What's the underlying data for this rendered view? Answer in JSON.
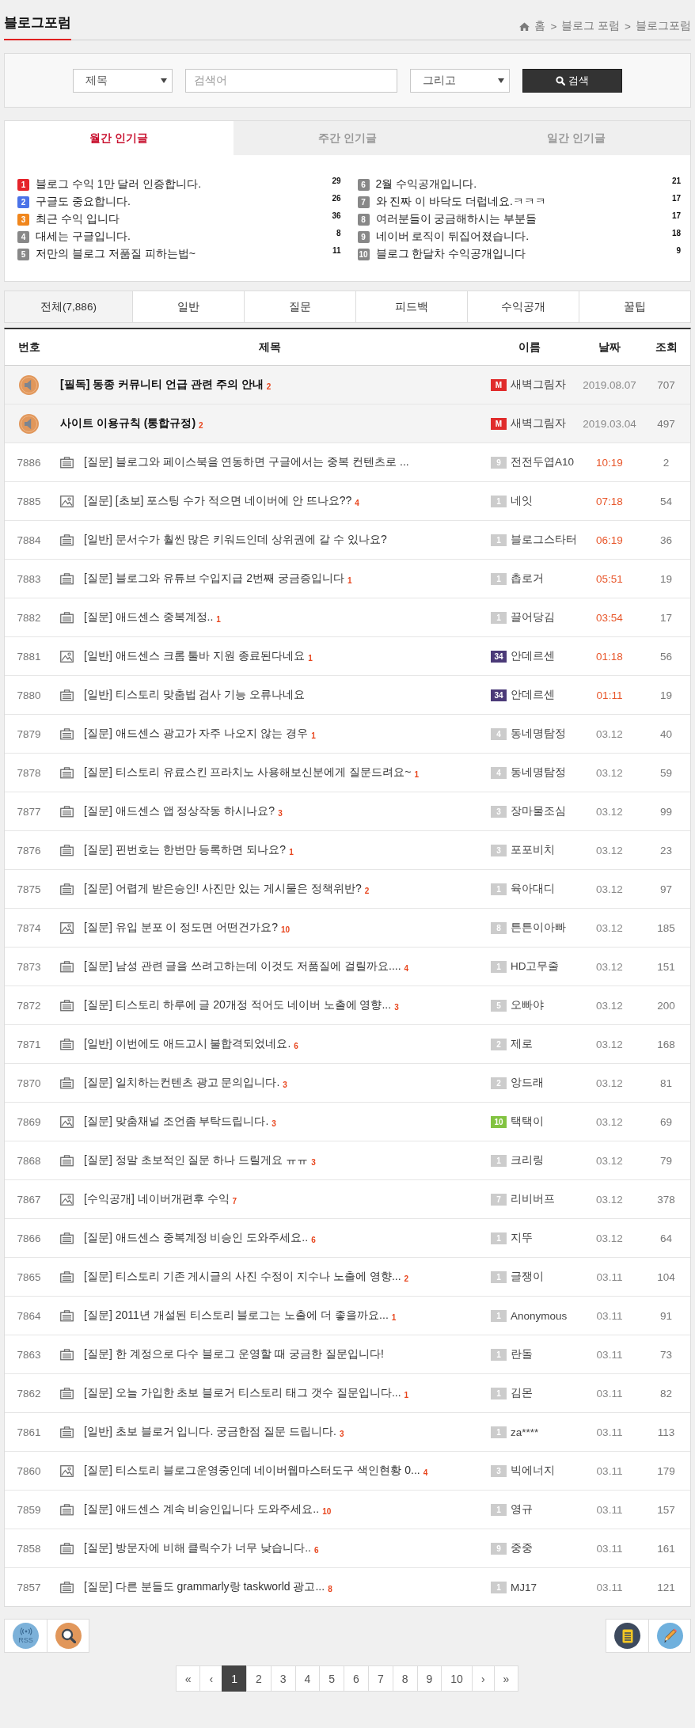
{
  "header": {
    "title": "블로그포럼",
    "breadcrumb": {
      "items": [
        "홈",
        "블로그 포럼",
        "블로그포럼"
      ],
      "separator": ">"
    }
  },
  "search": {
    "field": "제목",
    "placeholder": "검색어",
    "operator": "그리고",
    "button": "검색"
  },
  "popular": {
    "tabs": [
      {
        "label": "월간 인기글",
        "selected": true
      },
      {
        "label": "주간 인기글",
        "selected": false
      },
      {
        "label": "일간 인기글",
        "selected": false
      }
    ],
    "items": [
      {
        "rank": "1",
        "color": "#e5242b",
        "title": "블로그 수익 1만 달러 인증합니다.",
        "count": "29"
      },
      {
        "rank": "2",
        "color": "#4a72e8",
        "title": "구글도 중요합니다.",
        "count": "26"
      },
      {
        "rank": "3",
        "color": "#f0861c",
        "title": "최근 수익 입니다",
        "count": "36"
      },
      {
        "rank": "4",
        "color": "#888888",
        "title": "대세는 구글입니다.",
        "count": "8"
      },
      {
        "rank": "5",
        "color": "#888888",
        "title": "저만의 블로그 저품질 피하는법~",
        "count": "11"
      },
      {
        "rank": "6",
        "color": "#888888",
        "title": "2월 수익공개입니다.",
        "count": "21"
      },
      {
        "rank": "7",
        "color": "#888888",
        "title": "와 진짜 이 바닥도 더럽네요.ㅋㅋㅋ",
        "count": "17"
      },
      {
        "rank": "8",
        "color": "#888888",
        "title": "여러분들이 궁금해하시는 부분들",
        "count": "17"
      },
      {
        "rank": "9",
        "color": "#888888",
        "title": "네이버 로직이 뒤집어졌습니다.",
        "count": "18"
      },
      {
        "rank": "10",
        "color": "#888888",
        "title": "블로그 한달차 수익공개입니다",
        "count": "9"
      }
    ]
  },
  "categories": [
    {
      "label": "전체(7,886)",
      "selected": true
    },
    {
      "label": "일반",
      "selected": false
    },
    {
      "label": "질문",
      "selected": false
    },
    {
      "label": "피드백",
      "selected": false
    },
    {
      "label": "수익공개",
      "selected": false
    },
    {
      "label": "꿀팁",
      "selected": false
    }
  ],
  "table": {
    "columns": [
      "번호",
      "제목",
      "이름",
      "날짜",
      "조회"
    ],
    "notices": [
      {
        "title": "[필독] 동종 커뮤니티 언급 관련 주의 안내",
        "comments": "2",
        "author": {
          "badge": "M",
          "color": "#e02b2b",
          "name": "새벽그림자"
        },
        "date": "2019.08.07",
        "views": "707"
      },
      {
        "title": "사이트 이용규칙 (통합규정)",
        "comments": "2",
        "author": {
          "badge": "M",
          "color": "#e02b2b",
          "name": "새벽그림자"
        },
        "date": "2019.03.04",
        "views": "497"
      }
    ],
    "posts": [
      {
        "number": "7886",
        "has_image": false,
        "title": "[질문] 블로그와 페이스북을 연동하면 구글에서는 중복 컨텐츠로 ...",
        "author": {
          "badge": "9",
          "color": "#cccccc",
          "name": "전전두엽A10"
        },
        "date": "10:19",
        "highlighted": true,
        "views": "2"
      },
      {
        "number": "7885",
        "has_image": true,
        "title": "[질문] [초보] 포스팅 수가 적으면 네이버에 안 뜨나요??",
        "comments": "4",
        "author": {
          "badge": "1",
          "color": "#cccccc",
          "name": "네잇"
        },
        "date": "07:18",
        "highlighted": true,
        "views": "54"
      },
      {
        "number": "7884",
        "has_image": false,
        "title": "[일반] 문서수가 훨씬 많은 키워드인데 상위권에 갈 수 있나요?",
        "author": {
          "badge": "1",
          "color": "#cccccc",
          "name": "블로그스타터"
        },
        "date": "06:19",
        "highlighted": true,
        "views": "36"
      },
      {
        "number": "7883",
        "has_image": false,
        "title": "[질문] 블로그와 유튜브 수입지급 2번째 궁금증입니다",
        "comments": "1",
        "author": {
          "badge": "1",
          "color": "#cccccc",
          "name": "촙로거"
        },
        "date": "05:51",
        "highlighted": true,
        "views": "19"
      },
      {
        "number": "7882",
        "has_image": false,
        "title": "[질문] 애드센스 중복계정..",
        "comments": "1",
        "author": {
          "badge": "1",
          "color": "#cccccc",
          "name": "끌어당김"
        },
        "date": "03:54",
        "highlighted": true,
        "views": "17"
      },
      {
        "number": "7881",
        "has_image": true,
        "title": "[일반] 애드센스 크롬 툴바 지원 종료된다네요",
        "comments": "1",
        "author": {
          "badge": "34",
          "color": "#4b3a78",
          "name": "안데르센"
        },
        "date": "01:18",
        "highlighted": true,
        "views": "56"
      },
      {
        "number": "7880",
        "has_image": false,
        "title": "[일반] 티스토리 맞춤법 검사 기능 오류나네요",
        "author": {
          "badge": "34",
          "color": "#4b3a78",
          "name": "안데르센"
        },
        "date": "01:11",
        "highlighted": true,
        "views": "19"
      },
      {
        "number": "7879",
        "has_image": false,
        "title": "[질문] 애드센스 광고가 자주 나오지 않는 경우",
        "comments": "1",
        "author": {
          "badge": "4",
          "color": "#cccccc",
          "name": "동네명탐정"
        },
        "date": "03.12",
        "highlighted": false,
        "views": "40"
      },
      {
        "number": "7878",
        "has_image": false,
        "title": "[질문] 티스토리 유료스킨 프라치노 사용해보신분에게 질문드려요~",
        "comments": "1",
        "author": {
          "badge": "4",
          "color": "#cccccc",
          "name": "동네명탐정"
        },
        "date": "03.12",
        "highlighted": false,
        "views": "59"
      },
      {
        "number": "7877",
        "has_image": false,
        "title": "[질문] 애드센스 앱 정상작동 하시나요?",
        "comments": "3",
        "author": {
          "badge": "3",
          "color": "#cccccc",
          "name": "장마물조심"
        },
        "date": "03.12",
        "highlighted": false,
        "views": "99"
      },
      {
        "number": "7876",
        "has_image": false,
        "title": "[질문] 핀번호는 한번만 등록하면 되나요?",
        "comments": "1",
        "author": {
          "badge": "3",
          "color": "#cccccc",
          "name": "포포비치"
        },
        "date": "03.12",
        "highlighted": false,
        "views": "23"
      },
      {
        "number": "7875",
        "has_image": false,
        "title": "[질문] 어렵게 받은승인! 사진만 있는 게시물은 정책위반?",
        "comments": "2",
        "author": {
          "badge": "1",
          "color": "#cccccc",
          "name": "육아대디"
        },
        "date": "03.12",
        "highlighted": false,
        "views": "97"
      },
      {
        "number": "7874",
        "has_image": true,
        "title": "[질문] 유입 분포 이 정도면 어떤건가요?",
        "comments": "10",
        "author": {
          "badge": "8",
          "color": "#cccccc",
          "name": "튼튼이아빠"
        },
        "date": "03.12",
        "highlighted": false,
        "views": "185"
      },
      {
        "number": "7873",
        "has_image": false,
        "title": "[질문] 남성 관련 글을 쓰려고하는데 이것도 저품질에 걸릴까요....",
        "comments": "4",
        "author": {
          "badge": "1",
          "color": "#cccccc",
          "name": "HD고무줄"
        },
        "date": "03.12",
        "highlighted": false,
        "views": "151"
      },
      {
        "number": "7872",
        "has_image": false,
        "title": "[질문] 티스토리 하루에 글 20개정 적어도 네이버 노출에 영향...",
        "comments": "3",
        "author": {
          "badge": "5",
          "color": "#cccccc",
          "name": "오빠야"
        },
        "date": "03.12",
        "highlighted": false,
        "views": "200"
      },
      {
        "number": "7871",
        "has_image": false,
        "title": "[일반] 이번에도 애드고시 불합격되었네요.",
        "comments": "6",
        "author": {
          "badge": "2",
          "color": "#cccccc",
          "name": "제로"
        },
        "date": "03.12",
        "highlighted": false,
        "views": "168"
      },
      {
        "number": "7870",
        "has_image": false,
        "title": "[질문] 일치하는컨텐츠 광고 문의입니다.",
        "comments": "3",
        "author": {
          "badge": "2",
          "color": "#cccccc",
          "name": "앙드래"
        },
        "date": "03.12",
        "highlighted": false,
        "views": "81"
      },
      {
        "number": "7869",
        "has_image": true,
        "title": "[질문] 맞춤채널 조언좀 부탁드립니다.",
        "comments": "3",
        "author": {
          "badge": "10",
          "color": "#82c341",
          "name": "택택이"
        },
        "date": "03.12",
        "highlighted": false,
        "views": "69"
      },
      {
        "number": "7868",
        "has_image": false,
        "title": "[질문] 정말 초보적인 질문 하나 드릴게요 ㅠㅠ",
        "comments": "3",
        "author": {
          "badge": "1",
          "color": "#cccccc",
          "name": "크리링"
        },
        "date": "03.12",
        "highlighted": false,
        "views": "79"
      },
      {
        "number": "7867",
        "has_image": true,
        "title": "[수익공개] 네이버개편후 수익",
        "comments": "7",
        "author": {
          "badge": "7",
          "color": "#cccccc",
          "name": "리비버프"
        },
        "date": "03.12",
        "highlighted": false,
        "views": "378"
      },
      {
        "number": "7866",
        "has_image": false,
        "title": "[질문] 애드센스 중복계정 비승인 도와주세요..",
        "comments": "6",
        "author": {
          "badge": "1",
          "color": "#cccccc",
          "name": "지뚜"
        },
        "date": "03.12",
        "highlighted": false,
        "views": "64"
      },
      {
        "number": "7865",
        "has_image": false,
        "title": "[질문] 티스토리 기존 게시글의 사진 수정이 지수나 노출에 영향...",
        "comments": "2",
        "author": {
          "badge": "1",
          "color": "#cccccc",
          "name": "글쟁이"
        },
        "date": "03.11",
        "highlighted": false,
        "views": "104"
      },
      {
        "number": "7864",
        "has_image": false,
        "title": "[질문] 2011년 개설된 티스토리 블로그는 노출에 더 좋을까요...",
        "comments": "1",
        "author": {
          "badge": "1",
          "color": "#cccccc",
          "name": "Anonymous"
        },
        "date": "03.11",
        "highlighted": false,
        "views": "91"
      },
      {
        "number": "7863",
        "has_image": false,
        "title": "[질문] 한 계정으로 다수 블로그 운영할 때 궁금한 질문입니다!",
        "author": {
          "badge": "1",
          "color": "#cccccc",
          "name": "란돌"
        },
        "date": "03.11",
        "highlighted": false,
        "views": "73"
      },
      {
        "number": "7862",
        "has_image": false,
        "title": "[질문] 오늘 가입한 초보 블로거 티스토리 태그 갯수 질문입니다...",
        "comments": "1",
        "author": {
          "badge": "1",
          "color": "#cccccc",
          "name": "김몬"
        },
        "date": "03.11",
        "highlighted": false,
        "views": "82"
      },
      {
        "number": "7861",
        "has_image": false,
        "title": "[일반] 초보 블로거 입니다. 궁금한점 질문 드립니다.",
        "comments": "3",
        "author": {
          "badge": "1",
          "color": "#cccccc",
          "name": "za****"
        },
        "date": "03.11",
        "highlighted": false,
        "views": "113"
      },
      {
        "number": "7860",
        "has_image": true,
        "title": "[질문] 티스토리 블로그운영중인데 네이버웹마스터도구 색인현황 0...",
        "comments": "4",
        "author": {
          "badge": "3",
          "color": "#cccccc",
          "name": "빅에너지"
        },
        "date": "03.11",
        "highlighted": false,
        "views": "179"
      },
      {
        "number": "7859",
        "has_image": false,
        "title": "[질문] 애드센스 계속 비승인입니다 도와주세요..",
        "comments": "10",
        "author": {
          "badge": "1",
          "color": "#cccccc",
          "name": "영규"
        },
        "date": "03.11",
        "highlighted": false,
        "views": "157"
      },
      {
        "number": "7858",
        "has_image": false,
        "title": "[질문] 방문자에 비해 클릭수가 너무 낮습니다..",
        "comments": "6",
        "author": {
          "badge": "9",
          "color": "#cccccc",
          "name": "중중"
        },
        "date": "03.11",
        "highlighted": false,
        "views": "161"
      },
      {
        "number": "7857",
        "has_image": false,
        "title": "[질문] 다른 분들도 grammarly랑 taskworld 광고...",
        "comments": "8",
        "author": {
          "badge": "1",
          "color": "#cccccc",
          "name": "MJ17"
        },
        "date": "03.11",
        "highlighted": false,
        "views": "121"
      }
    ]
  },
  "toolbar_left": [
    {
      "kind": "rss",
      "label": "RSS"
    },
    {
      "kind": "search"
    }
  ],
  "toolbar_right": [
    {
      "kind": "list"
    },
    {
      "kind": "write"
    }
  ],
  "pagination": {
    "first": "«",
    "prev": "‹",
    "pages": [
      {
        "label": "1",
        "selected": true
      },
      {
        "label": "2",
        "selected": false
      },
      {
        "label": "3",
        "selected": false
      },
      {
        "label": "4",
        "selected": false
      },
      {
        "label": "5",
        "selected": false
      },
      {
        "label": "6",
        "selected": false
      },
      {
        "label": "7",
        "selected": false
      },
      {
        "label": "8",
        "selected": false
      },
      {
        "label": "9",
        "selected": false
      },
      {
        "label": "10",
        "selected": false
      }
    ],
    "next": "›",
    "last": "»"
  }
}
